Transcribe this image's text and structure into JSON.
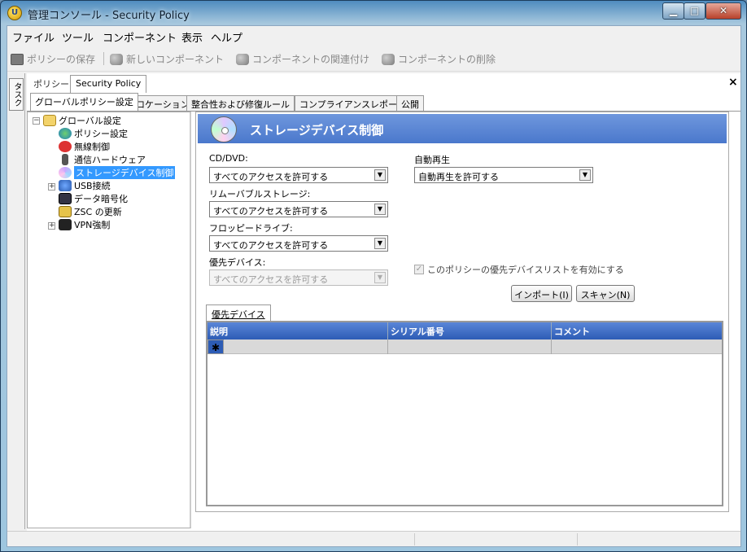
{
  "window": {
    "title": "管理コンソール - Security Policy",
    "app_icon": "U"
  },
  "menu": [
    "ファイル",
    "ツール",
    "コンポーネント",
    "表示",
    "ヘルプ"
  ],
  "toolbar": {
    "save": "ポリシーの保存",
    "new_component": "新しいコンポーネント",
    "link_component": "コンポーネントの関連付け",
    "delete_component": "コンポーネントの削除"
  },
  "tasks_label": "タスク",
  "doc_tab": {
    "label": "ポリシー",
    "name": "Security Policy",
    "close": "×"
  },
  "policy_tabs": [
    "グローバルポリシー設定",
    "ロケーション",
    "整合性および修復ルール",
    "コンプライアンスレポート",
    "公開"
  ],
  "tree": {
    "root": "グローバル設定",
    "items": [
      "ポリシー設定",
      "無線制御",
      "通信ハードウェア",
      "ストレージデバイス制御",
      "USB接続",
      "データ暗号化",
      "ZSC の更新",
      "VPN強制"
    ]
  },
  "content": {
    "title": "ストレージデバイス制御",
    "cd_label": "CD/DVD:",
    "cd_value": "すべてのアクセスを許可する",
    "removable_label": "リムーバブルストレージ:",
    "removable_value": "すべてのアクセスを許可する",
    "floppy_label": "フロッピードライブ:",
    "floppy_value": "すべてのアクセスを許可する",
    "preferred_label": "優先デバイス:",
    "preferred_value": "すべてのアクセスを許可する",
    "autoplay_label": "自動再生",
    "autoplay_value": "自動再生を許可する",
    "checkbox_label": "このポリシーの優先デバイスリストを有効にする",
    "import_button": "インポート(I)",
    "scan_button": "スキャン(N)",
    "subtab": "優先デバイス",
    "grid_columns": [
      "説明",
      "シリアル番号",
      "コメント"
    ],
    "new_row_marker": "✱"
  }
}
